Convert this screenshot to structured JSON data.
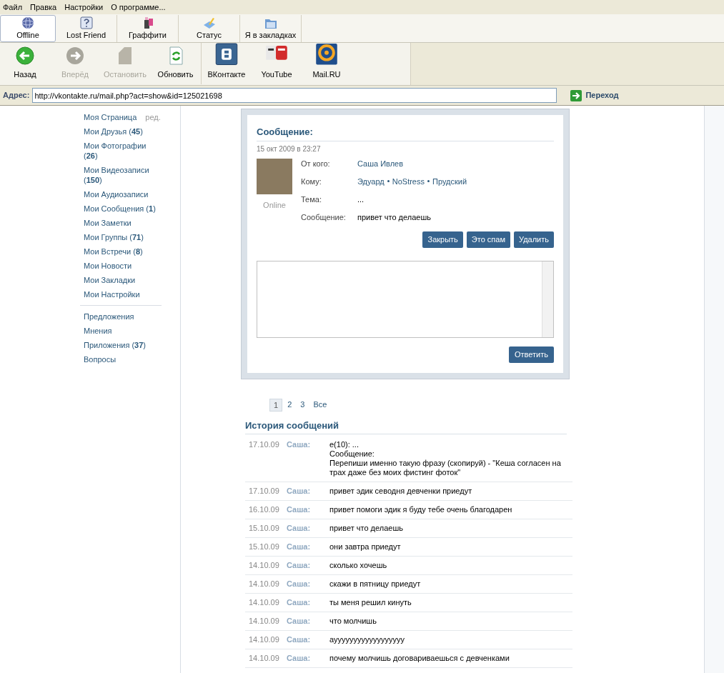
{
  "menu": [
    "Файл",
    "Правка",
    "Настройки",
    "О программе..."
  ],
  "tabs": [
    {
      "label": "Offline",
      "kind": "globe",
      "selected": true
    },
    {
      "label": "Lost Friend",
      "kind": "question",
      "selected": false
    },
    {
      "label": "Граффити",
      "kind": "graffiti",
      "selected": false
    },
    {
      "label": "Статус",
      "kind": "status",
      "selected": false
    },
    {
      "label": "Я в закладках",
      "kind": "folder",
      "selected": false
    }
  ],
  "nav_buttons": [
    {
      "label": "Назад",
      "kind": "back",
      "disabled": false
    },
    {
      "label": "Вперёд",
      "kind": "forward",
      "disabled": true
    },
    {
      "label": "Остановить",
      "kind": "stop",
      "disabled": true
    },
    {
      "label": "Обновить",
      "kind": "refresh",
      "disabled": false
    },
    {
      "label": "ВКонтакте",
      "kind": "vk",
      "disabled": false
    },
    {
      "label": "YouTube",
      "kind": "youtube",
      "disabled": false
    },
    {
      "label": "Mail.RU",
      "kind": "mail",
      "disabled": false
    }
  ],
  "address": {
    "label": "Адрес:",
    "value": "http://vkontakte.ru/mail.php?act=show&id=125021698",
    "go": "Переход"
  },
  "sidebar": {
    "edit": "ред.",
    "items": [
      "Моя Страница",
      "Мои Друзья (**45**)",
      "Мои Фотографии (**26**)",
      "Мои Видеозаписи (**150**)",
      "Мои Аудиозаписи",
      "Мои Сообщения (**1**)",
      "Мои Заметки",
      "Мои Группы (**71**)",
      "Мои Встречи (**8**)",
      "Мои Новости",
      "Мои Закладки",
      "Мои Настройки"
    ],
    "secondary": [
      "Предложения",
      "Мнения",
      "Приложения (**37**)",
      "Вопросы"
    ]
  },
  "message": {
    "title": "Сообщение:",
    "date": "15 окт 2009 в 23:27",
    "status": "Online",
    "fields": [
      {
        "label": "От кого:",
        "kind": "link",
        "values": [
          "Саша Ивлев"
        ]
      },
      {
        "label": "Кому:",
        "kind": "link",
        "values": [
          "Эдуард",
          "NoStress",
          "Прудский"
        ]
      },
      {
        "label": "Тема:",
        "kind": "text",
        "values": [
          "..."
        ]
      },
      {
        "label": "Сообщение:",
        "kind": "text",
        "values": [
          "привет что делаешь"
        ]
      }
    ],
    "buttons": [
      "Закрыть",
      "Это спам",
      "Удалить"
    ],
    "reply": "Ответить"
  },
  "pagination": [
    {
      "label": "1",
      "selected": true
    },
    {
      "label": "2",
      "selected": false
    },
    {
      "label": "3",
      "selected": false
    },
    {
      "label": "Все",
      "selected": false
    }
  ],
  "history": {
    "title": "История сообщений",
    "rows": [
      {
        "date": "17.10.09",
        "author": "Саша:",
        "text": "е(10): ...\nСообщение:\nПерепиши именно такую фразу (скопируй) - \"Кеша согласен на трах даже без моих фистинг фоток\""
      },
      {
        "date": "17.10.09",
        "author": "Саша:",
        "text": "привет эдик севодня девченки приедут"
      },
      {
        "date": "16.10.09",
        "author": "Саша:",
        "text": "привет помоги эдик я буду тебе очень благодарен"
      },
      {
        "date": "15.10.09",
        "author": "Саша:",
        "text": "привет что делаешь"
      },
      {
        "date": "15.10.09",
        "author": "Саша:",
        "text": "они завтра приедут"
      },
      {
        "date": "14.10.09",
        "author": "Саша:",
        "text": "сколько хочешь"
      },
      {
        "date": "14.10.09",
        "author": "Саша:",
        "text": "скажи в пятницу приедут"
      },
      {
        "date": "14.10.09",
        "author": "Саша:",
        "text": "ты меня решил кинуть"
      },
      {
        "date": "14.10.09",
        "author": "Саша:",
        "text": "что молчишь"
      },
      {
        "date": "14.10.09",
        "author": "Саша:",
        "text": "ауууууууууууууууууу"
      },
      {
        "date": "14.10.09",
        "author": "Саша:",
        "text": "почему молчишь договариваешься с девченками"
      }
    ]
  }
}
